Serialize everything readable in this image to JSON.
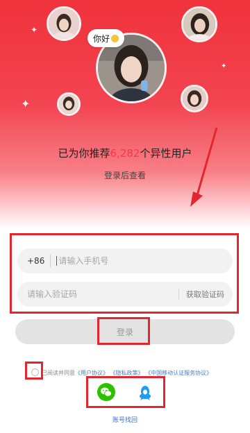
{
  "hero": {
    "greeting": "你好",
    "headline_before": "已为你推荐",
    "headline_count": "6,282",
    "headline_after": "个异性用户",
    "subline": "登录后查看"
  },
  "phone": {
    "country_code": "+86",
    "placeholder": "请输入手机号"
  },
  "code": {
    "placeholder": "请输入验证码",
    "get_code_label": "获取验证码"
  },
  "login_button_label": "登录",
  "agreement": {
    "prefix": "已阅读并同意",
    "user_agreement": "《用户协议》",
    "privacy_policy": "《隐私政策》",
    "mobile_auth_agreement": "《中国移动认证服务协议》",
    "checked": false
  },
  "social": {
    "icons": [
      "wechat-icon",
      "qq-icon"
    ]
  },
  "recover_label": "账号找回",
  "colors": {
    "accent": "#f33a45",
    "annotation": "#e1262e",
    "link": "#4a7cc0"
  }
}
